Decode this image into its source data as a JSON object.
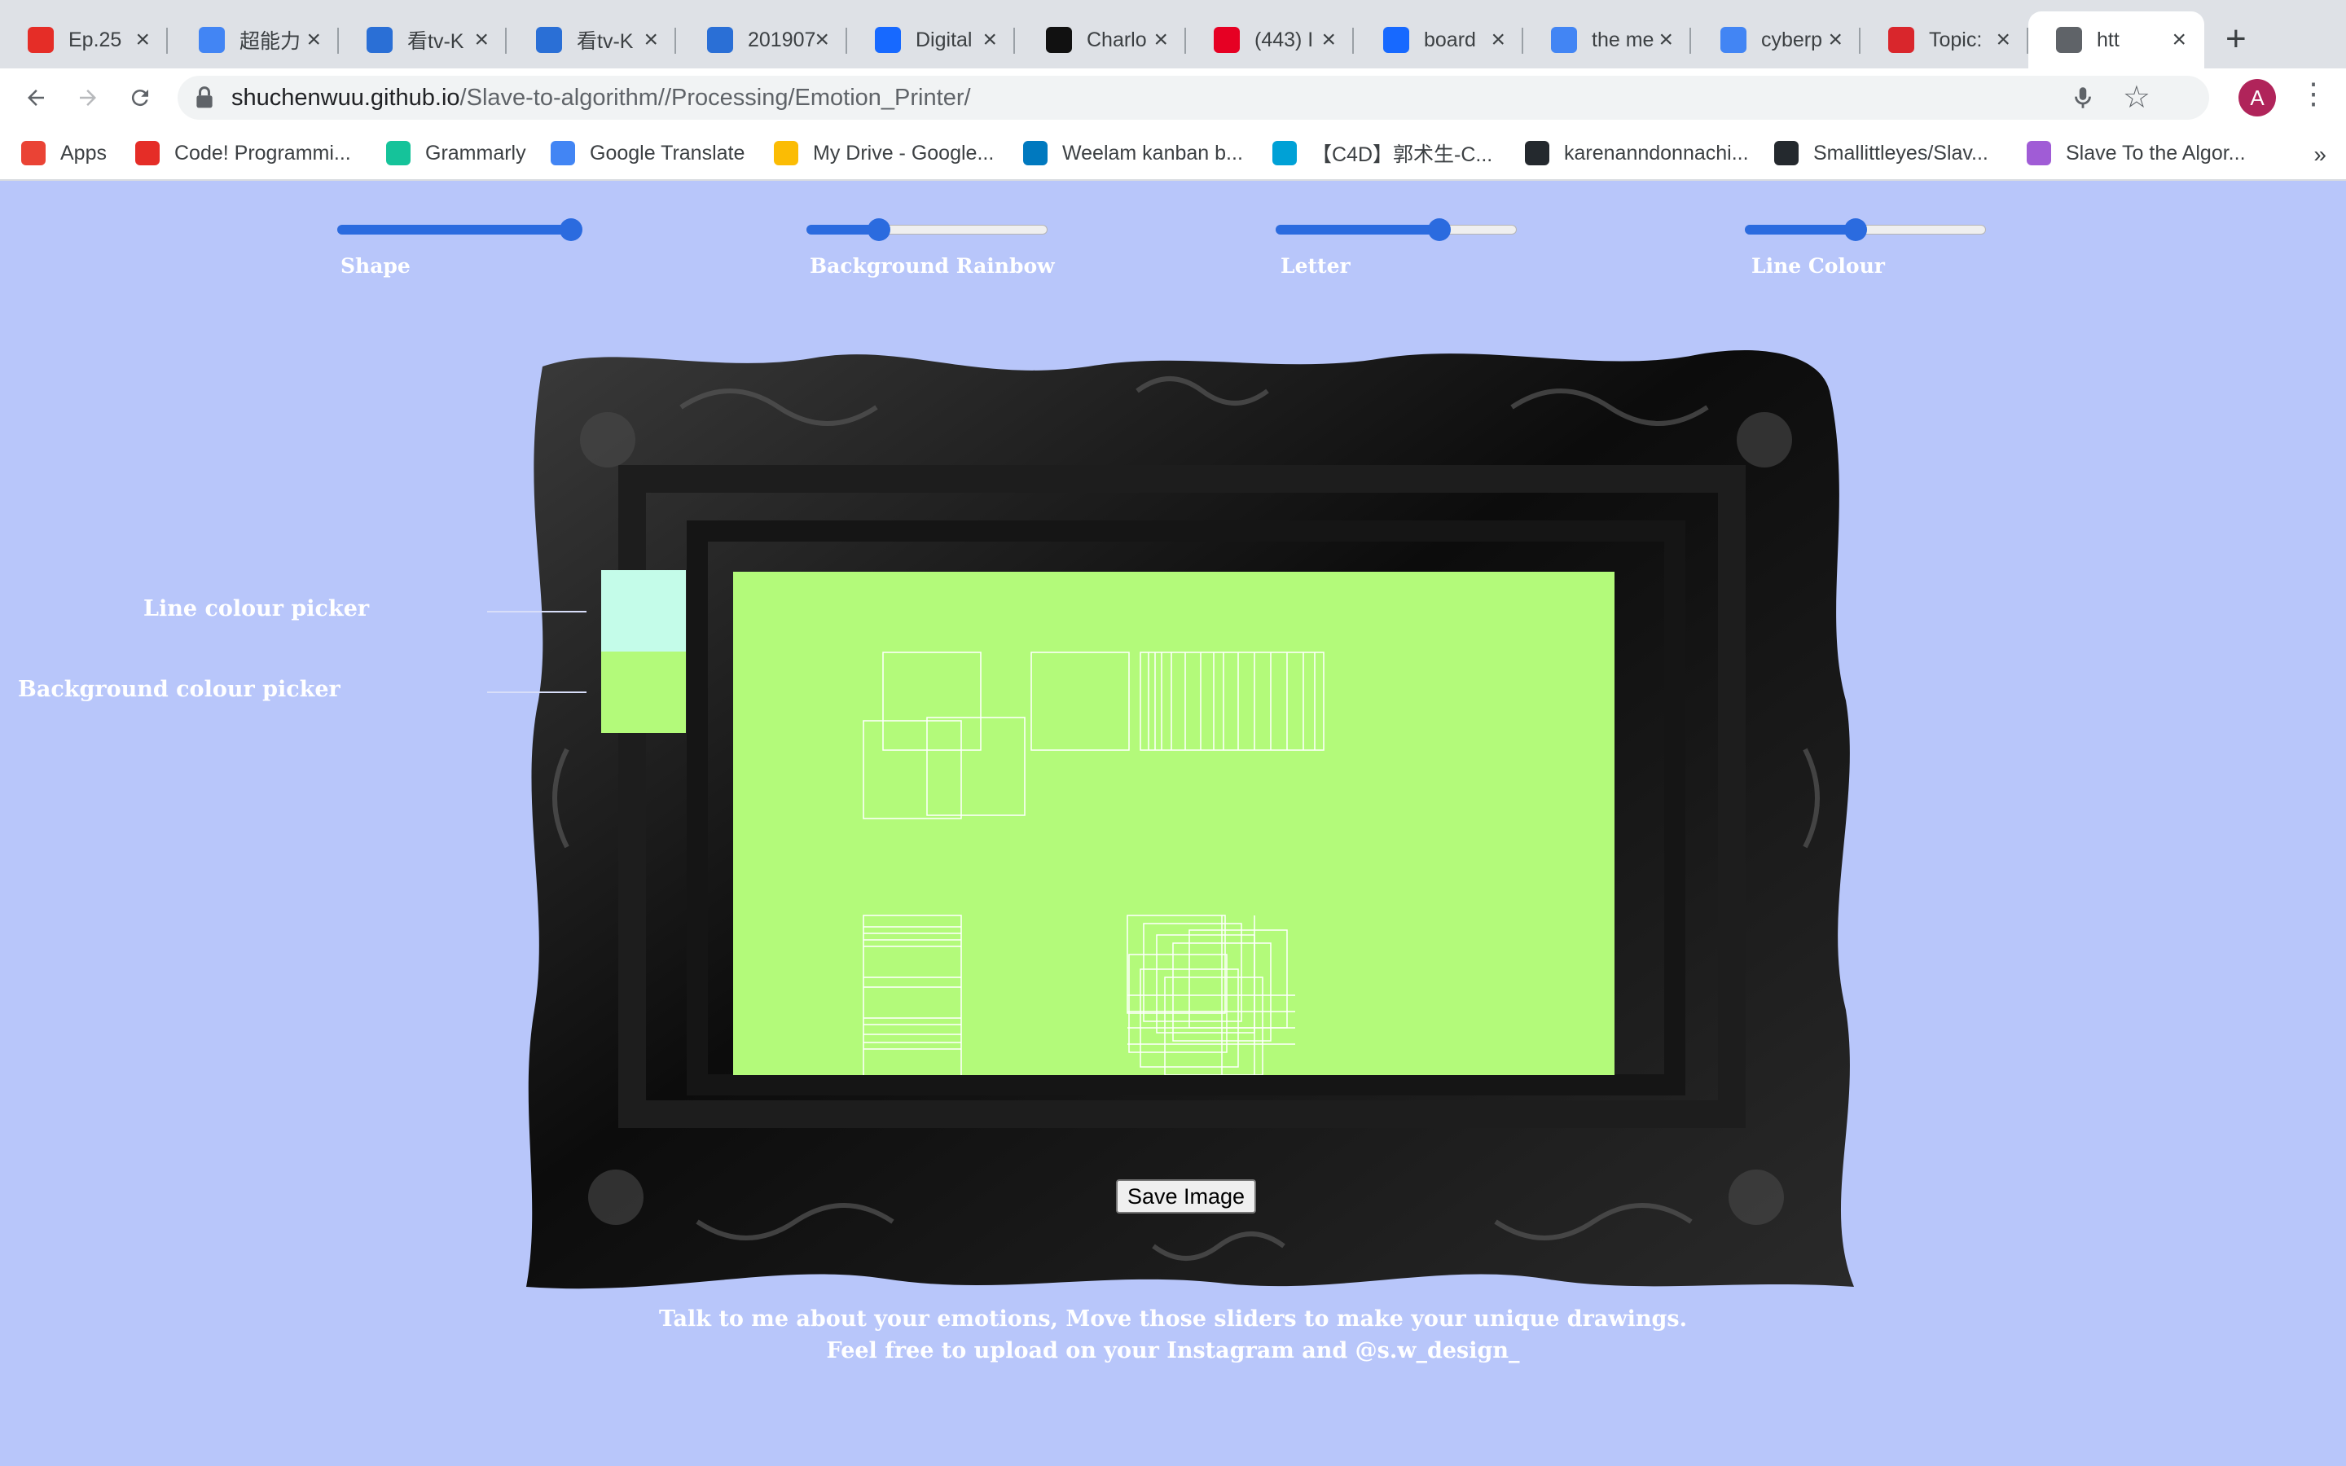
{
  "browser": {
    "tabs": [
      {
        "title": "Ep.25",
        "icon": "youtube-icon",
        "color": "#e52d27"
      },
      {
        "title": "超能力",
        "icon": "google-icon",
        "color": "#4285f4"
      },
      {
        "title": "看tv-K",
        "icon": "tv-icon",
        "color": "#2a6fd6"
      },
      {
        "title": "看tv-K",
        "icon": "tv-icon",
        "color": "#2a6fd6"
      },
      {
        "title": "201907",
        "icon": "tv-icon",
        "color": "#2a6fd6"
      },
      {
        "title": "Digital",
        "icon": "behance-icon",
        "color": "#1769ff"
      },
      {
        "title": "Charlo",
        "icon": "c-logo-icon",
        "color": "#111111"
      },
      {
        "title": "(443) I",
        "icon": "pinterest-icon",
        "color": "#e60023"
      },
      {
        "title": "board",
        "icon": "behance-icon",
        "color": "#1769ff"
      },
      {
        "title": "the me",
        "icon": "google-icon",
        "color": "#4285f4"
      },
      {
        "title": "cyberp",
        "icon": "google-icon",
        "color": "#4285f4"
      },
      {
        "title": "Topic:",
        "icon": "topic-icon",
        "color": "#d9262c"
      },
      {
        "title": "htt",
        "icon": "globe-icon",
        "color": "#5f6368",
        "active": true
      }
    ],
    "url_host": "shuchenwuu.github.io",
    "url_path": "/Slave-to-algorithm//Processing/Emotion_Printer/",
    "avatar_letter": "A",
    "bookmarks": [
      {
        "label": "Apps",
        "icon": "apps-grid-icon",
        "color": "#ea4335"
      },
      {
        "label": "Code! Programmi...",
        "icon": "youtube-icon",
        "color": "#e52d27"
      },
      {
        "label": "Grammarly",
        "icon": "grammarly-icon",
        "color": "#15c39a"
      },
      {
        "label": "Google Translate",
        "icon": "translate-icon",
        "color": "#4285f4"
      },
      {
        "label": "My Drive - Google...",
        "icon": "drive-icon",
        "color": "#fbbc04"
      },
      {
        "label": "Weelam kanban b...",
        "icon": "trello-icon",
        "color": "#0079bf"
      },
      {
        "label": "【C4D】郭术生-C...",
        "icon": "bilibili-icon",
        "color": "#00a1d6"
      },
      {
        "label": "karenanndonnachi...",
        "icon": "github-icon",
        "color": "#24292e"
      },
      {
        "label": "Smallittleyes/Slav...",
        "icon": "github-icon",
        "color": "#24292e"
      },
      {
        "label": "Slave To the Algor...",
        "icon": "play-icon",
        "color": "#a05cd6"
      }
    ],
    "more": "»"
  },
  "page": {
    "sliders": [
      {
        "label": "Shape",
        "value": 0.97
      },
      {
        "label": "Background Rainbow",
        "value": 0.3
      },
      {
        "label": "Letter",
        "value": 0.68
      },
      {
        "label": "Line Colour",
        "value": 0.46
      }
    ],
    "line_colour_label": "Line colour picker",
    "background_colour_label": "Background colour picker",
    "line_colour": "#c4fce9",
    "background_colour": "#b3fa7a",
    "save_button": "Save Image",
    "footer_line1": "Talk to me about your emotions, Move those sliders to make your unique drawings.",
    "footer_line2": "Feel free to upload on your Instagram and @s.w_design_",
    "accent": "#2b6bdf",
    "page_background": "#b8c6fa"
  }
}
